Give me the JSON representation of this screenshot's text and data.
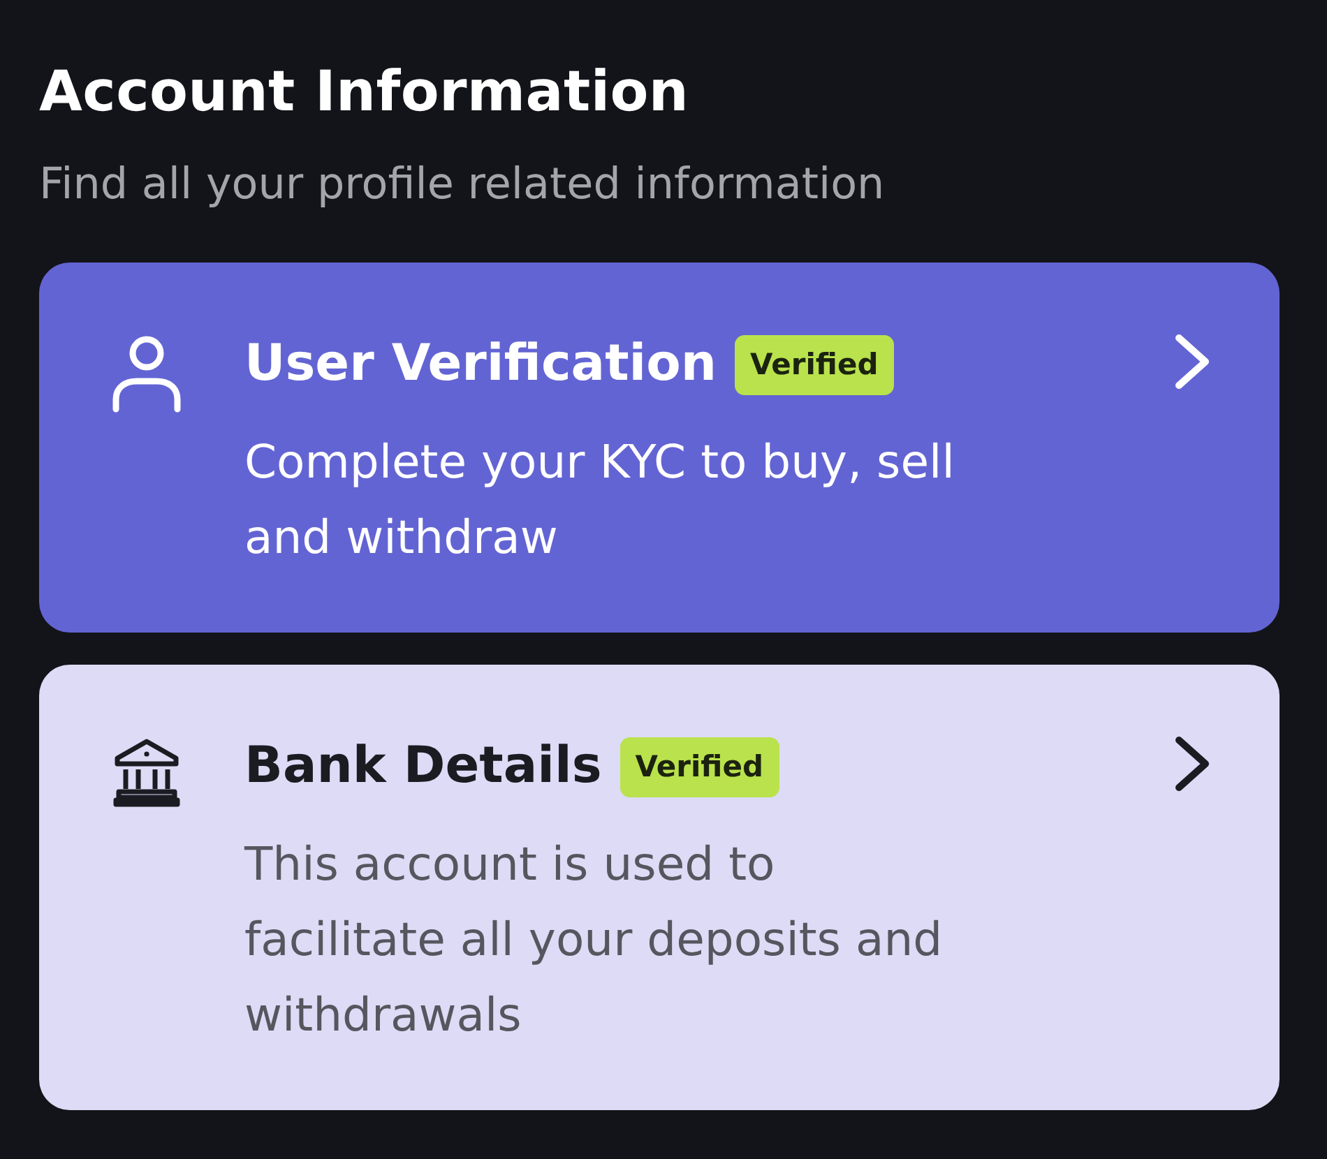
{
  "header": {
    "title": "Account Information",
    "subtitle": "Find all your profile related information"
  },
  "cards": [
    {
      "title": "User Verification",
      "badge": "Verified",
      "description_lines": [
        "Complete your KYC to buy, sell",
        "and withdraw"
      ],
      "selected": true
    },
    {
      "title": "Bank Details",
      "badge": "Verified",
      "description_lines": [
        "This account is used to",
        "facilitate all your deposits and",
        "withdrawals"
      ],
      "selected": false
    }
  ]
}
